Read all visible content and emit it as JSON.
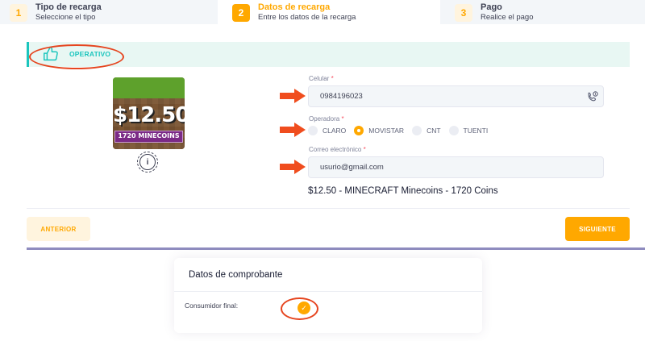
{
  "stepper": {
    "steps": [
      {
        "num": "1",
        "title": "Tipo de recarga",
        "subtitle": "Seleccione el tipo"
      },
      {
        "num": "2",
        "title": "Datos de recarga",
        "subtitle": "Entre los datos de la recarga"
      },
      {
        "num": "3",
        "title": "Pago",
        "subtitle": "Realice el pago"
      }
    ]
  },
  "status": {
    "label": "OPERATIVO",
    "icon": "thumbs-up-icon"
  },
  "product": {
    "price": "$12.50",
    "badge": "1720 MINECOINS",
    "info_icon": "info-icon"
  },
  "form": {
    "phone": {
      "label": "Celular",
      "required": "*",
      "value": "0984196023",
      "icon": "phone-icon"
    },
    "operator": {
      "label": "Operadora",
      "required": "*",
      "options": [
        "CLARO",
        "MOVISTAR",
        "CNT",
        "TUENTI"
      ],
      "selected": "MOVISTAR"
    },
    "email": {
      "label": "Correo electrónico",
      "required": "*",
      "value": "usurio@gmail.com"
    },
    "summary": "$12.50 - MINECRAFT Minecoins - 1720 Coins"
  },
  "buttons": {
    "prev": "ANTERIOR",
    "next": "SIGUIENTE"
  },
  "comprobante": {
    "title": "Datos de comprobante",
    "consumer_label": "Consumidor final:",
    "consumer_checked": true
  },
  "colors": {
    "accent": "#ffa800",
    "success": "#1bc5bd",
    "annotation": "#e6451f"
  }
}
